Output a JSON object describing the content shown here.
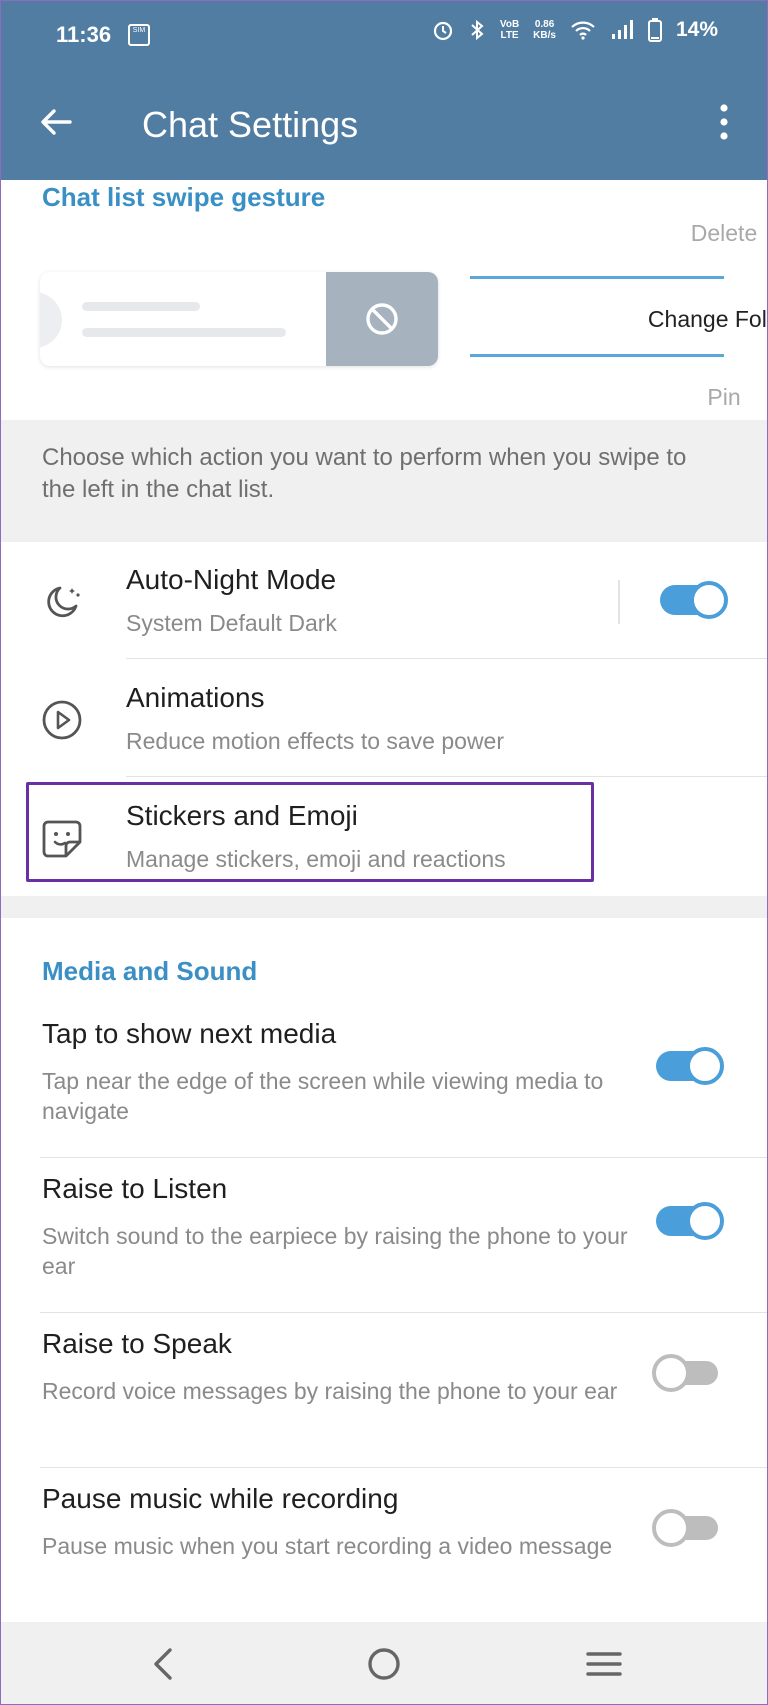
{
  "status_bar": {
    "time": "11:36",
    "sim_icon_text": "SIM",
    "net_speed_value": "0.86",
    "net_speed_unit": "KB/s",
    "volte_line1": "VoB",
    "volte_line2": "LTE",
    "battery_text": "14%"
  },
  "app_bar": {
    "title": "Chat Settings"
  },
  "swipe": {
    "header": "Chat list swipe gesture",
    "options": {
      "above": "Delete",
      "selected": "Change Folder",
      "below": "Pin"
    },
    "description": "Choose which action you want to perform when you swipe to the left in the chat list."
  },
  "rows": [
    {
      "icon": "moon-icon",
      "title": "Auto-Night Mode",
      "subtitle": "System Default Dark",
      "toggle": true
    },
    {
      "icon": "play-circle-icon",
      "title": "Animations",
      "subtitle": "Reduce motion effects to save power"
    },
    {
      "icon": "sticker-icon",
      "title": "Stickers and Emoji",
      "subtitle": "Manage stickers, emoji and reactions"
    }
  ],
  "media": {
    "header": "Media and Sound",
    "items": [
      {
        "title": "Tap to show next media",
        "subtitle": "Tap near the edge of the screen while viewing media to navigate",
        "on": true
      },
      {
        "title": "Raise to Listen",
        "subtitle": "Switch sound to the earpiece by raising the phone to your ear",
        "on": true
      },
      {
        "title": "Raise to Speak",
        "subtitle": "Record voice messages by raising the phone to your ear",
        "on": false
      },
      {
        "title": "Pause music while recording",
        "subtitle": "Pause music when you start recording a video message",
        "on": false
      }
    ]
  },
  "colors": {
    "header_bg": "#517da2",
    "accent": "#3a8fc5",
    "toggle_on": "#4a9fdb",
    "highlight": "#6a2fa3"
  }
}
